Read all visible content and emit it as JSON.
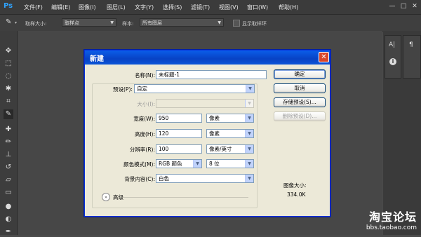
{
  "app": {
    "logo": "Ps"
  },
  "menu": [
    "文件(F)",
    "编辑(E)",
    "图像(I)",
    "图层(L)",
    "文字(Y)",
    "选择(S)",
    "滤镜(T)",
    "视图(V)",
    "窗口(W)",
    "帮助(H)"
  ],
  "window_buttons": {
    "minimize": "—",
    "maximize": "□",
    "close": "✕"
  },
  "options_bar": {
    "sample_size_label": "取样大小:",
    "sample_size_value": "取样点",
    "sample_label": "样本:",
    "sample_value": "所有图层",
    "show_ring_label": "显示取样环"
  },
  "tools": [
    "move-icon",
    "marquee-icon",
    "lasso-icon",
    "magic-wand-icon",
    "crop-icon",
    "eyedropper-icon",
    "healing-icon",
    "brush-icon",
    "stamp-icon",
    "history-brush-icon",
    "eraser-icon",
    "gradient-icon",
    "blur-icon",
    "dodge-icon",
    "pen-icon"
  ],
  "right_panel": {
    "icon_a": "A|",
    "icon_b": "¶",
    "icon_c": "i"
  },
  "dialog": {
    "title": "新建",
    "close": "✕",
    "name_label": "名称(N):",
    "name_value": "未标题-1",
    "preset_label": "预设(P):",
    "preset_value": "自定",
    "size_label": "大小(I):",
    "size_value": "",
    "width_label": "宽度(W):",
    "width_value": "950",
    "width_unit": "像素",
    "height_label": "高度(H):",
    "height_value": "120",
    "height_unit": "像素",
    "resolution_label": "分辨率(R):",
    "resolution_value": "100",
    "resolution_unit": "像素/英寸",
    "color_mode_label": "颜色模式(M):",
    "color_mode_value": "RGB 颜色",
    "bit_depth_value": "8 位",
    "background_label": "背景内容(C):",
    "background_value": "白色",
    "advanced_label": "高级",
    "ok_label": "确定",
    "cancel_label": "取消",
    "save_preset_label": "存储预设(S)...",
    "delete_preset_label": "删除预设(D)...",
    "image_size_label": "图像大小:",
    "image_size_value": "334.0K"
  },
  "watermark": {
    "title": "淘宝论坛",
    "subtitle": "bbs.taobao.com"
  }
}
